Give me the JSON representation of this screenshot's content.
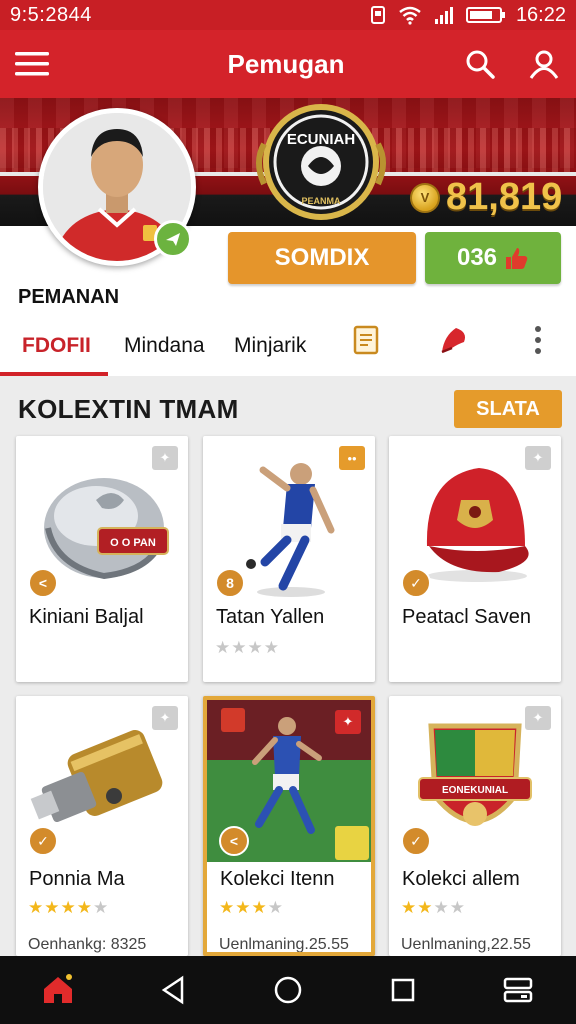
{
  "status_bar": {
    "left_text": "9:5:2844",
    "time": "16:22"
  },
  "app_bar": {
    "title": "Pemugan",
    "icons": [
      "menu-icon",
      "search-icon",
      "profile-icon"
    ]
  },
  "hero": {
    "crest_text_top": "ECUNIAH",
    "crest_text_bottom": "PEANMA",
    "coin_symbol": "V",
    "coin_value": "81,819"
  },
  "profile": {
    "name": "PEMANAN",
    "primary_button": "SOMDIX",
    "secondary_button": "036"
  },
  "tabs": {
    "items": [
      {
        "label": "FDOFII"
      },
      {
        "label": "Mindana"
      },
      {
        "label": "Minjarik"
      }
    ],
    "icons": [
      "document-icon",
      "flag-icon",
      "more-icon"
    ]
  },
  "section": {
    "title": "KOLEXTIN TMAM",
    "action_label": "SLATA"
  },
  "cards": [
    {
      "name": "Kiniani Baljal",
      "badge": "<",
      "image": "helmet-icon",
      "banner": "O O PAN"
    },
    {
      "name": "Tatan Yallen",
      "badge": "8",
      "image": "player-kick-icon",
      "stars": 0,
      "stars_total": 4
    },
    {
      "name": "Peatacl Saven",
      "badge": "✓",
      "image": "cap-icon"
    },
    {
      "name": "Ponnia Ma",
      "badge": "✓",
      "image": "canister-icon",
      "stars": 4,
      "stars_total": 5,
      "meta": "Oenhankg: 8325"
    },
    {
      "name": "Kolekci Itenn",
      "badge": "<",
      "image": "player-photo-icon",
      "stars": 3,
      "stars_total": 4,
      "meta": "Uenlmaning.25.55"
    },
    {
      "name": "Kolekci allem",
      "badge": "✓",
      "image": "crest-icon",
      "banner": "EONEKUNIAL",
      "stars": 2,
      "stars_total": 4,
      "meta": "Uenlmaning,22.55"
    }
  ],
  "colors": {
    "primary_red": "#d4232a",
    "accent_orange": "#e5952b",
    "accent_green": "#6fb23d",
    "coin_gold": "#f0c24a"
  },
  "navigation": {
    "icons": [
      "home-icon",
      "back-icon",
      "circle-home-icon",
      "recents-icon",
      "switch-icon"
    ]
  }
}
